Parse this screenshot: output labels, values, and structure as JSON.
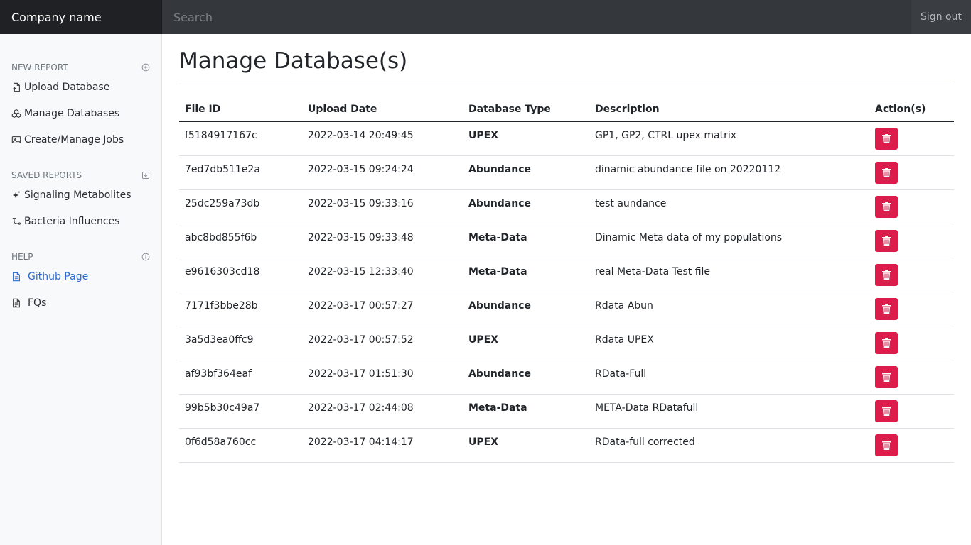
{
  "navbar": {
    "brand": "Company name",
    "search_placeholder": "Search",
    "signout_label": "Sign out"
  },
  "sidebar": {
    "sections": [
      {
        "title": "NEW REPORT",
        "icon": "plus-circle-icon",
        "items": [
          {
            "label": "Upload Database",
            "icon": "file-upload-icon"
          },
          {
            "label": "Manage Databases",
            "icon": "boxes-icon"
          },
          {
            "label": "Create/Manage Jobs",
            "icon": "image-file-icon"
          }
        ]
      },
      {
        "title": "SAVED REPORTS",
        "icon": "download-box-icon",
        "items": [
          {
            "label": "Signaling Metabolites",
            "icon": "sparkles-icon"
          },
          {
            "label": "Bacteria Influences",
            "icon": "branch-icon"
          }
        ]
      },
      {
        "title": "HELP",
        "icon": "info-circle-icon",
        "items": [
          {
            "label": "Github Page",
            "icon": "document-icon"
          },
          {
            "label": "FQs",
            "icon": "document-icon"
          }
        ]
      }
    ]
  },
  "main": {
    "title": "Manage Database(s)",
    "columns": [
      "File ID",
      "Upload Date",
      "Database Type",
      "Description",
      "Action(s)"
    ],
    "rows": [
      {
        "file_id": "f5184917167c",
        "date": "2022-03-14 20:49:45",
        "type": "UPEX",
        "description": "GP1, GP2, CTRL upex matrix"
      },
      {
        "file_id": "7ed7db511e2a",
        "date": "2022-03-15 09:24:24",
        "type": "Abundance",
        "description": "dinamic abundance file on 20220112"
      },
      {
        "file_id": "25dc259a73db",
        "date": "2022-03-15 09:33:16",
        "type": "Abundance",
        "description": "test aundance"
      },
      {
        "file_id": "abc8bd855f6b",
        "date": "2022-03-15 09:33:48",
        "type": "Meta-Data",
        "description": "Dinamic Meta data of my populations"
      },
      {
        "file_id": "e9616303cd18",
        "date": "2022-03-15 12:33:40",
        "type": "Meta-Data",
        "description": "real Meta-Data Test file"
      },
      {
        "file_id": "7171f3bbe28b",
        "date": "2022-03-17 00:57:27",
        "type": "Abundance",
        "description": "Rdata Abun"
      },
      {
        "file_id": "3a5d3ea0ffc9",
        "date": "2022-03-17 00:57:52",
        "type": "UPEX",
        "description": "Rdata UPEX"
      },
      {
        "file_id": "af93bf364eaf",
        "date": "2022-03-17 01:51:30",
        "type": "Abundance",
        "description": "RData-Full"
      },
      {
        "file_id": "99b5b30c49a7",
        "date": "2022-03-17 02:44:08",
        "type": "Meta-Data",
        "description": "META-Data RDatafull"
      },
      {
        "file_id": "0f6d58a760cc",
        "date": "2022-03-17 04:14:17",
        "type": "UPEX",
        "description": "RData-full corrected"
      }
    ],
    "action_icon": "trash-icon"
  },
  "colors": {
    "navbar_bg": "#2f3236",
    "brand_bg": "#1f2124",
    "sidebar_bg": "#f8f9fa",
    "link": "#2d6ad1",
    "danger": "#dc1c4a"
  }
}
